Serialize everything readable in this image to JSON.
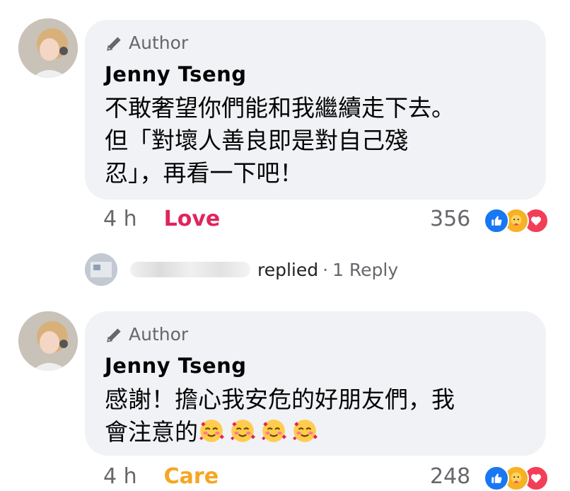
{
  "comments": [
    {
      "author_badge": "Author",
      "name": "Jenny  Tseng",
      "lines": [
        "不敢奢望你們能和我繼續走下去。",
        "但「對壞人善良即是對自己殘",
        "忍」，再看一下吧！"
      ],
      "time": "4 h",
      "reaction_label": "Love",
      "reaction_color": "#e0245e",
      "count": "356"
    },
    {
      "author_badge": "Author",
      "name": "Jenny  Tseng",
      "lines": [
        "感謝！擔心我安危的好朋友們，我",
        "會注意的"
      ],
      "emoji_count": 4,
      "emoji_icon": "smiling-face-with-hearts-icon",
      "time": "4 h",
      "reaction_label": "Care",
      "reaction_color": "#f5a623",
      "count": "248"
    }
  ],
  "reply_row": {
    "replied": "replied",
    "separator": "·",
    "reply_link": "1 Reply"
  }
}
